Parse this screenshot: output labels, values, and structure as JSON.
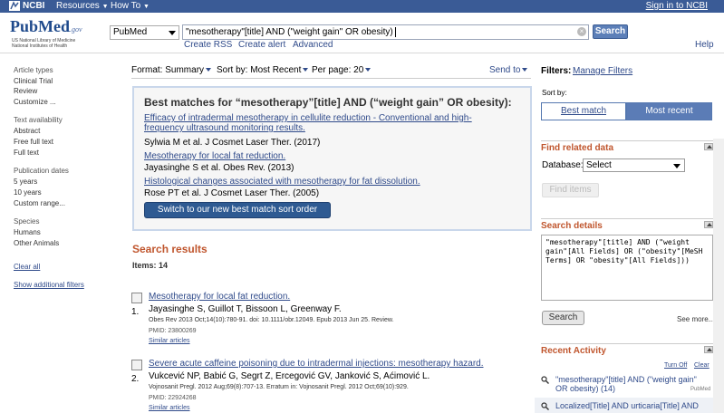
{
  "ncbi_bar": {
    "logo": "NCBI",
    "resources": "Resources",
    "howto": "How To",
    "signin": "Sign in to NCBI"
  },
  "header": {
    "logo_text": "PubMed",
    "logo_gov": ".gov",
    "logo_sub1": "US National Library of Medicine",
    "logo_sub2": "National Institutes of Health",
    "database": "PubMed",
    "query": "\"mesotherapy\"[title] AND (\"weight gain\" OR obesity)",
    "search_label": "Search",
    "create_rss": "Create RSS",
    "create_alert": "Create alert",
    "advanced": "Advanced",
    "help": "Help"
  },
  "sidebar": {
    "article_types_title": "Article types",
    "article_types": [
      "Clinical Trial",
      "Review",
      "Customize ..."
    ],
    "text_avail_title": "Text availability",
    "text_avail": [
      "Abstract",
      "Free full text",
      "Full text"
    ],
    "pub_dates_title": "Publication dates",
    "pub_dates": [
      "5 years",
      "10 years",
      "Custom range..."
    ],
    "species_title": "Species",
    "species": [
      "Humans",
      "Other Animals"
    ],
    "clear_all": "Clear all",
    "show_filters": "Show additional filters"
  },
  "format_bar": {
    "format_label": "Format:",
    "format_value": "Summary",
    "sort_label": "Sort by:",
    "sort_value": "Most Recent",
    "perpage_label": "Per page:",
    "perpage_value": "20",
    "send_to": "Send to"
  },
  "best_matches": {
    "title": "Best matches for “mesotherapy”[title] AND (“weight gain” OR obesity):",
    "items": [
      {
        "title_line1": "Efficacy of intradermal mesotherapy in cellulite reduction - Conventional and high-",
        "title_line2": "frequency ultrasound monitoring results.",
        "cite": "Sylwia M et al. J Cosmet Laser Ther. (2017)"
      },
      {
        "title_line1": "Mesotherapy for local fat reduction.",
        "cite": "Jayasinghe S et al. Obes Rev. (2013)"
      },
      {
        "title_line1": "Histological changes associated with mesotherapy for fat dissolution.",
        "cite": "Rose PT et al. J Cosmet Laser Ther. (2005)"
      }
    ],
    "switch_label": "Switch to our new best match sort order"
  },
  "results": {
    "title": "Search results",
    "items_count": "Items: 14",
    "rows": [
      {
        "num": "1.",
        "title": "Mesotherapy for local fat reduction.",
        "authors": "Jayasinghe S, Guillot T, Bissoon L, Greenway F.",
        "source": "Obes Rev 2013 Oct;14(10):780-91. doi: 10.1111/obr.12049. Epub 2013 Jun 25. Review.",
        "pmid": "PMID: 23800269",
        "similar": "Similar articles"
      },
      {
        "num": "2.",
        "title": "Severe acute caffeine poisoning due to intradermal injections: mesotherapy hazard.",
        "authors": "Vukcević NP, Babić G, Segrt Z, Ercegović GV, Janković S, Aćimović L.",
        "source": "Vojnosanit Pregl. 2012 Aug;69(8):707-13. Erratum in: Vojnosanit Pregl. 2012 Oct;69(10):929.",
        "pmid": "PMID: 22924268",
        "similar": "Similar articles"
      }
    ]
  },
  "right_panel": {
    "filters_label": "Filters:",
    "manage_filters": "Manage Filters",
    "sort_by": "Sort by:",
    "sort_best": "Best match",
    "sort_recent": "Most recent",
    "related_title": "Find related data",
    "database_label": "Database:",
    "database_value": "Select",
    "find_items": "Find items",
    "details_title": "Search details",
    "details_text": "\"mesotherapy\"[title] AND (\"weight gain\"[All Fields] OR (\"obesity\"[MeSH Terms] OR \"obesity\"[All Fields]))",
    "details_search": "Search",
    "see_more": "See more...",
    "activity_title": "Recent Activity",
    "turn_off": "Turn Off",
    "clear": "Clear",
    "activity": [
      {
        "line1": "\"mesotherapy\"[title] AND (\"weight gain\"",
        "line2": "OR obesity) (14)",
        "src": "PubMed"
      },
      {
        "line1": "Localized[Title] AND urticaria[Title] AND"
      }
    ]
  }
}
